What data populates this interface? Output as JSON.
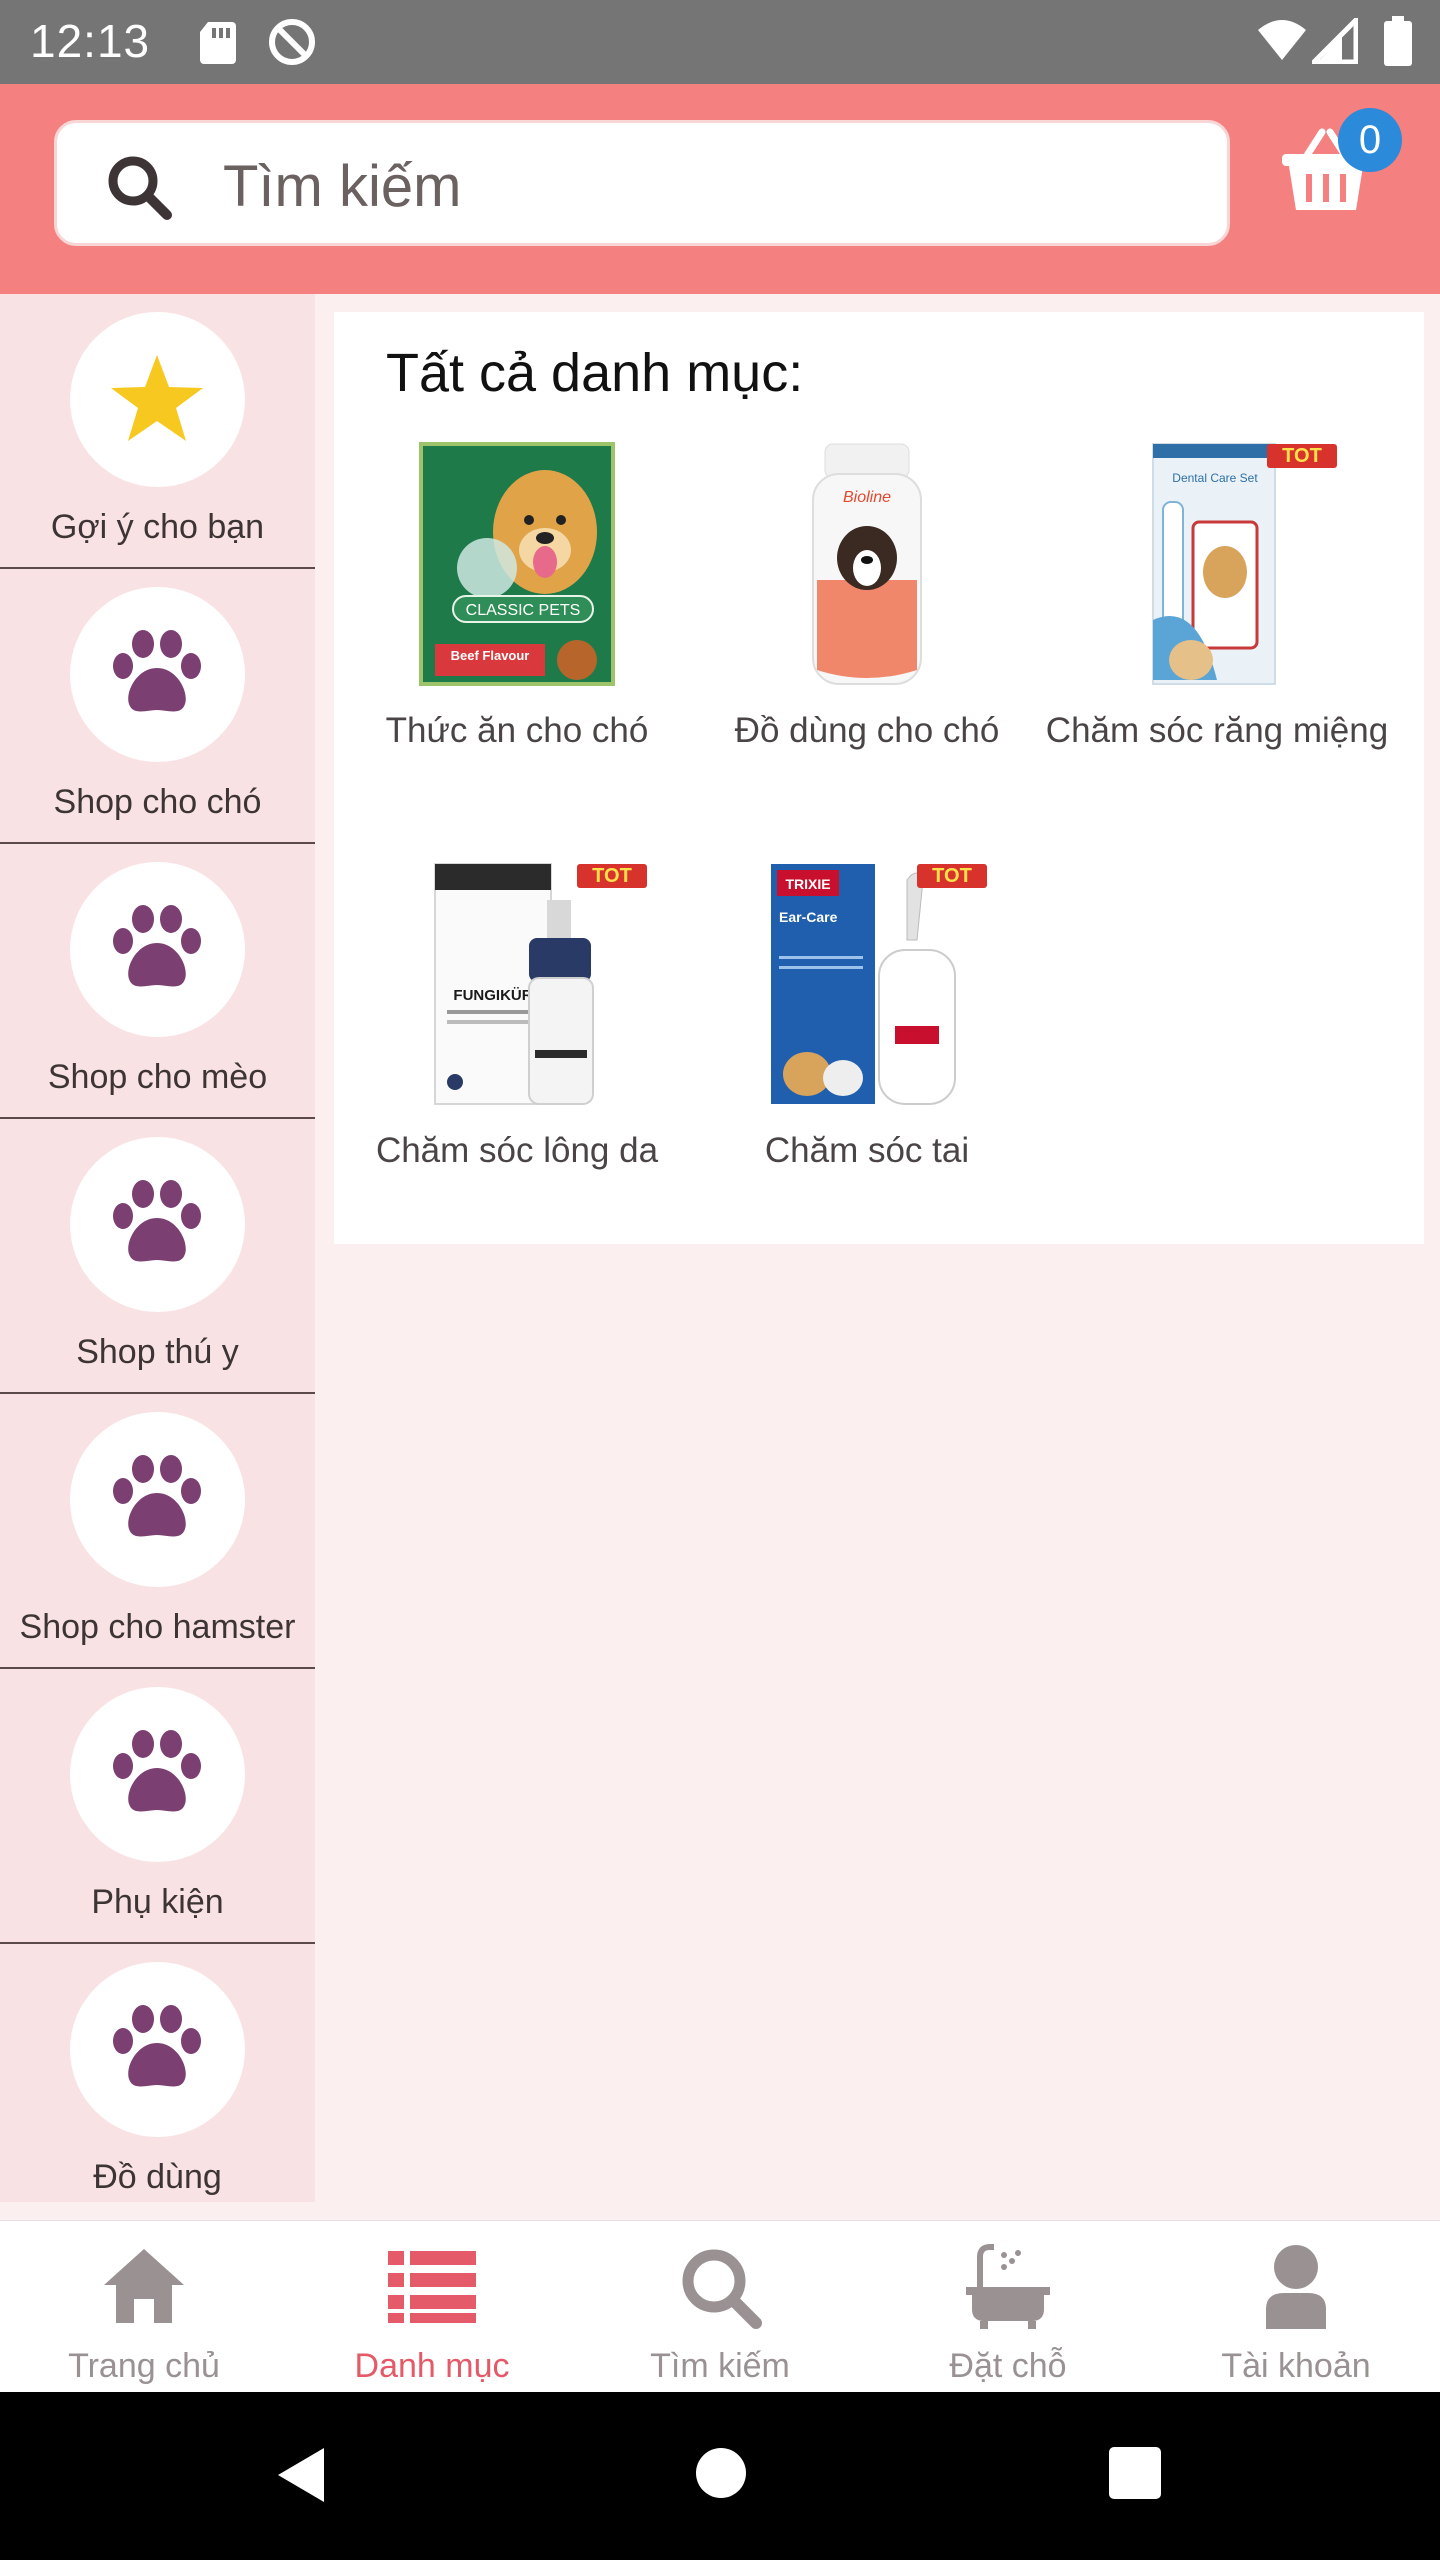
{
  "status_bar": {
    "time": "12:13",
    "icons": [
      "sd-card-icon",
      "sync-disabled-icon",
      "wifi-icon",
      "signal-icon",
      "battery-icon"
    ]
  },
  "header": {
    "search_placeholder": "Tìm kiếm",
    "cart_count": "0",
    "colors": {
      "header_bg": "#f58080",
      "badge": "#2b8ad9"
    }
  },
  "sidebar": {
    "items": [
      {
        "label": "Gợi ý cho bạn",
        "icon": "star-icon"
      },
      {
        "label": "Shop cho chó",
        "icon": "paw-icon"
      },
      {
        "label": "Shop cho mèo",
        "icon": "paw-icon"
      },
      {
        "label": "Shop thú y",
        "icon": "paw-icon"
      },
      {
        "label": "Shop cho hamster",
        "icon": "paw-icon"
      },
      {
        "label": "Phụ kiện",
        "icon": "paw-icon"
      },
      {
        "label": "Đồ dùng",
        "icon": "paw-icon"
      }
    ],
    "colors": {
      "paw": "#7b3f72",
      "star": "#f7c820"
    }
  },
  "main": {
    "title": "Tất cả danh mục:",
    "categories": [
      {
        "name": "Thức ăn cho chó",
        "image_text": "CLASSIC PETS",
        "sub_text": "Beef Flavour"
      },
      {
        "name": "Đồ dùng cho chó",
        "image_text": "Bioline"
      },
      {
        "name": "Chăm sóc răng miệng",
        "image_text": "Dental Care Set",
        "badge": "TOT"
      },
      {
        "name": "Chăm sóc lông da",
        "image_text": "FUNGIKÜR",
        "badge": "TOT"
      },
      {
        "name": "Chăm sóc tai",
        "image_text": "TRIXIE",
        "sub_text": "Ear-Care",
        "badge": "TOT"
      }
    ]
  },
  "bottom_nav": {
    "items": [
      {
        "label": "Trang chủ",
        "icon": "home-icon"
      },
      {
        "label": "Danh mục",
        "icon": "list-icon",
        "active": true
      },
      {
        "label": "Tìm kiếm",
        "icon": "search-icon"
      },
      {
        "label": "Đặt chỗ",
        "icon": "bathtub-icon"
      },
      {
        "label": "Tài khoản",
        "icon": "user-icon"
      }
    ],
    "colors": {
      "active": "#e45a68",
      "inactive": "#9a9292"
    }
  }
}
